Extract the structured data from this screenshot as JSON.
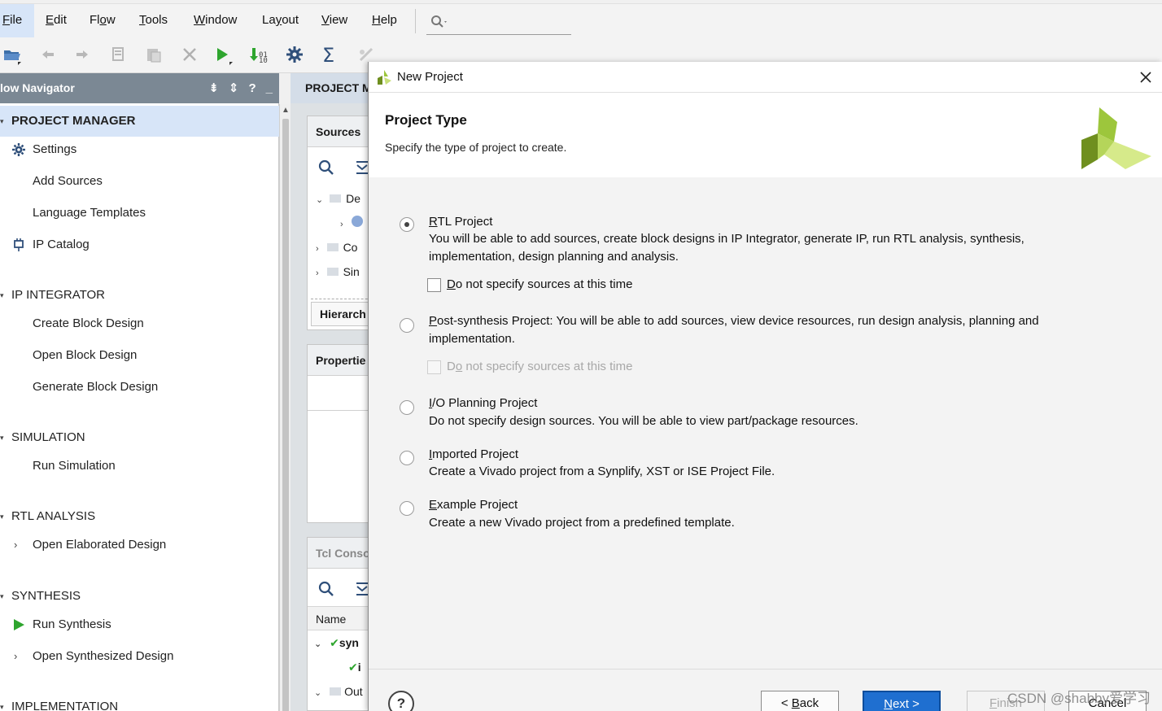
{
  "menubar": {
    "items": [
      {
        "key": "F",
        "rest": "ile",
        "active": true
      },
      {
        "key": "E",
        "rest": "dit"
      },
      {
        "key": "",
        "rest": "Fl",
        "key2": "o",
        "rest2": "w"
      },
      {
        "key": "T",
        "rest": "ools"
      },
      {
        "key": "W",
        "rest": "indow"
      },
      {
        "key": "",
        "rest": "La",
        "key2": "y",
        "rest2": "out"
      },
      {
        "key": "V",
        "rest": "iew"
      },
      {
        "key": "H",
        "rest": "elp"
      }
    ]
  },
  "navigator": {
    "title": "low Navigator",
    "sections": {
      "project_manager": "PROJECT MANAGER",
      "ip_integrator": "IP INTEGRATOR",
      "simulation": "SIMULATION",
      "rtl_analysis": "RTL ANALYSIS",
      "synthesis": "SYNTHESIS",
      "implementation": "IMPLEMENTATION"
    },
    "items": {
      "settings": "Settings",
      "add_sources": "Add Sources",
      "language_templates": "Language Templates",
      "ip_catalog": "IP Catalog",
      "create_block_design": "Create Block Design",
      "open_block_design": "Open Block Design",
      "generate_block_design": "Generate Block Design",
      "run_simulation": "Run Simulation",
      "open_elaborated_design": "Open Elaborated Design",
      "run_synthesis": "Run Synthesis",
      "open_synthesized_design": "Open Synthesized Design"
    }
  },
  "middle": {
    "header": "PROJECT M",
    "sources_title": "Sources",
    "tree": [
      "De",
      "Co",
      "Sin"
    ],
    "hierarchy_tab": "Hierarch",
    "properties_title": "Propertie",
    "tcl_title": "Tcl Conso",
    "name_col": "Name",
    "rows": [
      "syn",
      "i",
      "Out"
    ]
  },
  "dialog": {
    "title": "New Project",
    "heading": "Project Type",
    "subtitle": "Specify the type of project to create.",
    "options": {
      "rtl": {
        "key": "R",
        "rest": "TL Project",
        "desc": "You will be able to add sources, create block designs in IP Integrator, generate IP, run RTL analysis, synthesis, implementation, design planning and analysis.",
        "checkbox_key": "D",
        "checkbox_rest": "o not specify sources at this time"
      },
      "post_synthesis": {
        "key": "P",
        "rest": "ost-synthesis Project: You will be able to add sources, view device resources, run design analysis, planning and",
        "desc": "implementation.",
        "checkbox_pre": "D",
        "checkbox_key": "o",
        "checkbox_rest": " not specify sources at this time"
      },
      "io_planning": {
        "key": "I",
        "rest": "/O Planning Project",
        "desc": "Do not specify design sources. You will be able to view part/package resources."
      },
      "imported": {
        "key": "I",
        "rest": "mported Project",
        "desc": "Create a Vivado project from a Synplify, XST or ISE Project File."
      },
      "example": {
        "key": "E",
        "rest": "xample Project",
        "desc": "Create a new Vivado project from a predefined template."
      }
    },
    "buttons": {
      "help": "?",
      "back_pre": "< ",
      "back_key": "B",
      "back_rest": "ack",
      "next_key": "N",
      "next_rest": "ext >",
      "finish_key": "F",
      "finish_rest": "inish",
      "cancel": "Cancel"
    }
  },
  "watermark": "CSDN @shabby爱学习",
  "colors": {
    "accent_blue": "#1f6fd0",
    "nav_header": "#7b8894",
    "selected_row": "#d7e5f8",
    "run_green": "#2ea52e",
    "xilinx_green": "#7fa625"
  }
}
